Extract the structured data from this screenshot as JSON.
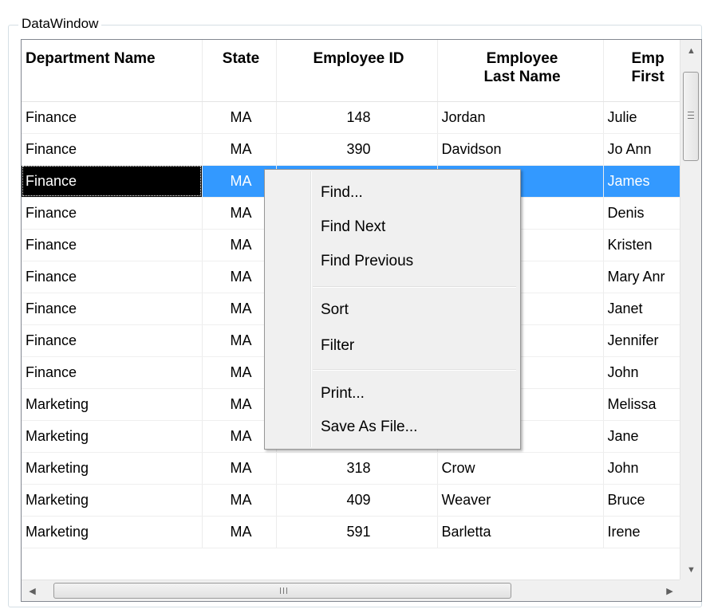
{
  "groupbox": {
    "title": "DataWindow"
  },
  "columns": [
    {
      "label": "Department Name",
      "align": "left"
    },
    {
      "label": "State",
      "align": "center"
    },
    {
      "label": "Employee ID",
      "align": "center"
    },
    {
      "label": "Employee Last Name",
      "align": "center"
    },
    {
      "label": "Emp First",
      "align": "center"
    }
  ],
  "rows": [
    [
      "Finance",
      "MA",
      "148",
      "Jordan",
      "Julie"
    ],
    [
      "Finance",
      "MA",
      "390",
      "Davidson",
      "Jo Ann"
    ],
    [
      "Finance",
      "MA",
      "",
      "",
      "James"
    ],
    [
      "Finance",
      "MA",
      "",
      "",
      "Denis"
    ],
    [
      "Finance",
      "MA",
      "",
      "",
      "Kristen"
    ],
    [
      "Finance",
      "MA",
      "",
      "",
      "Mary Anr"
    ],
    [
      "Finance",
      "MA",
      "",
      "",
      "Janet"
    ],
    [
      "Finance",
      "MA",
      "",
      "",
      "Jennifer"
    ],
    [
      "Finance",
      "MA",
      "",
      "",
      "John"
    ],
    [
      "Marketing",
      "MA",
      "",
      "",
      "Melissa"
    ],
    [
      "Marketing",
      "MA",
      "",
      "",
      "Jane"
    ],
    [
      "Marketing",
      "MA",
      "318",
      "Crow",
      "John"
    ],
    [
      "Marketing",
      "MA",
      "409",
      "Weaver",
      "Bruce"
    ],
    [
      "Marketing",
      "MA",
      "591",
      "Barletta",
      "Irene"
    ]
  ],
  "selected_row_index": 2,
  "context_menu": {
    "items": [
      "Find...",
      "Find Next",
      "Find Previous",
      "Sort",
      "Filter",
      "Print...",
      "Save As File..."
    ]
  },
  "colors": {
    "selection": "#3399ff",
    "focus": "#000000"
  }
}
